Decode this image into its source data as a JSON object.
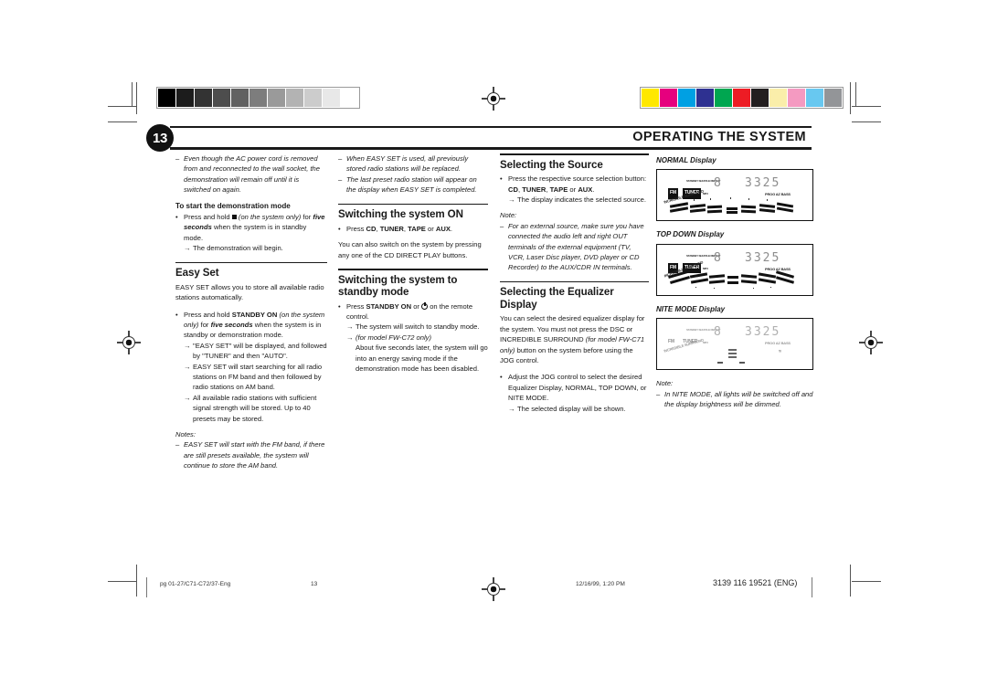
{
  "page": {
    "number": "13",
    "chapter_title": "OPERATING THE SYSTEM"
  },
  "colorbars": {
    "grayscale": [
      "#000000",
      "#1c1c1c",
      "#333333",
      "#4d4d4d",
      "#616161",
      "#7d7d7d",
      "#9a9a9a",
      "#b3b3b3",
      "#cccccc",
      "#e8e8e8",
      "#ffffff"
    ],
    "color": [
      "#ffe800",
      "#e6007e",
      "#00a0e3",
      "#2e3191",
      "#00a650",
      "#ed1c24",
      "#231f20",
      "#faeeaa",
      "#f49ac1",
      "#68c8f0",
      "#939598"
    ]
  },
  "column1": {
    "note_dash_1": "Even though the AC power cord is removed from and reconnected to the wall socket, the demonstration will remain off until it is switched on again.",
    "subhead_demo": "To start the demonstration mode",
    "bullet_demo_a": "Press and hold",
    "bullet_demo_b": "(on the system only)",
    "bullet_demo_c": "for",
    "bullet_demo_d": "five seconds",
    "bullet_demo_e": "when the system is in standby mode.",
    "arrow_demo": "The demonstration will begin.",
    "easyset_title": "Easy Set",
    "easyset_intro": "EASY SET allows you to store all available radio stations automatically.",
    "easyset_bullet_a": "Press and hold",
    "easyset_bullet_b": "STANDBY ON",
    "easyset_bullet_c": "(on the system only)",
    "easyset_bullet_d": "for",
    "easyset_bullet_e": "five seconds",
    "easyset_bullet_f": "when the system is in standby or demonstration mode.",
    "easyset_arrow_1": "\"EASY SET\" will be displayed, and followed by \"TUNER\" and then \"AUTO\".",
    "easyset_arrow_2": "EASY SET will start searching for all radio stations on FM band and then followed by radio stations on AM band.",
    "easyset_arrow_3": "All available radio stations with sufficient signal strength will be stored. Up to 40 presets may be stored.",
    "notes_label": "Notes:",
    "note_dash_2": "EASY SET will start with the FM band, if there are still presets available, the system will continue to store the AM band."
  },
  "column2": {
    "note_dash_1": "When EASY SET is used, all previously stored radio stations will be replaced.",
    "note_dash_2": "The last preset radio station will appear on the display when EASY SET is completed.",
    "switch_on_title": "Switching the system ON",
    "switch_on_bullet_a": "Press",
    "switch_on_bullet_cd": "CD",
    "switch_on_bullet_tuner": "TUNER",
    "switch_on_bullet_tape": "TAPE",
    "switch_on_bullet_or": "or",
    "switch_on_bullet_aux": "AUX",
    "switch_on_body": "You can also switch on the system by pressing any one of the CD DIRECT PLAY buttons.",
    "standby_title": "Switching the system to standby mode",
    "standby_bullet_a": "Press",
    "standby_bullet_b": "STANDBY ON",
    "standby_bullet_c": "or",
    "standby_bullet_d": "on the remote control.",
    "standby_arrow_1": "The system will switch to standby mode.",
    "standby_arrow_2_i": "(for model FW-C72 only)",
    "standby_arrow_2": "About five seconds later, the system will go into an energy saving mode if the demonstration mode has been disabled."
  },
  "column3": {
    "source_title": "Selecting the Source",
    "source_bullet_a": "Press the respective source selection button:",
    "source_cd": "CD",
    "source_tuner": "TUNER",
    "source_tape": "TAPE",
    "source_or": "or",
    "source_aux": "AUX",
    "source_arrow": "The display indicates the selected source.",
    "note_label": "Note:",
    "note_dash": "For an external source, make sure you have connected the audio left and right OUT terminals of the external equipment (TV, VCR, Laser Disc player, DVD player or CD Recorder) to the AUX/CDR IN terminals.",
    "eq_title": "Selecting the Equalizer Display",
    "eq_body_a": "You can select the desired equalizer display for the system. You must not press the DSC or INCREDIBLE SURROUND",
    "eq_body_i": "(for model FW-C71 only)",
    "eq_body_b": "button on the system before using the JOG control.",
    "eq_bullet": "Adjust the JOG control to select the desired Equalizer Display, NORMAL, TOP DOWN, or NITE MODE.",
    "eq_arrow": "The selected display will be shown."
  },
  "column4": {
    "display_normal_label": "NORMAL Display",
    "display_topdown_label": "TOP DOWN Display",
    "display_nite_label": "NITE MODE Display",
    "lcd": {
      "track": "8",
      "time": "3325",
      "band_fm": "FM",
      "band_tuner": "TUNER",
      "mp3": "MP3",
      "flags_right": "PROG AZ BASS",
      "incredible": "INCREDIBLE SURROUND",
      "top_labels": "STANDBY  SHUFFLE  REPEAT"
    },
    "note_label": "Note:",
    "note_dash": "In NITE MODE, all lights will be switched off and the display brightness will be dimmed."
  },
  "footer": {
    "file": "pg 01-27/C71-C72/37-Eng",
    "page": "13",
    "date": "12/16/99, 1:20 PM",
    "code": "3139 116 19521 (ENG)"
  }
}
